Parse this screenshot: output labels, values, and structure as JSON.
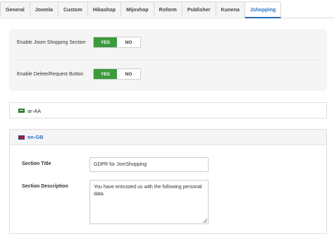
{
  "tabs": [
    {
      "label": "General"
    },
    {
      "label": "Joomla"
    },
    {
      "label": "Custom"
    },
    {
      "label": "Hikashop"
    },
    {
      "label": "Mijoshop"
    },
    {
      "label": "Rsform"
    },
    {
      "label": "Publisher"
    },
    {
      "label": "Kunena"
    },
    {
      "label": "Jshopping",
      "active": true
    }
  ],
  "settings": {
    "enable_section": {
      "label": "Enable Joom Shopping Section",
      "yes": "YES",
      "no": "NO",
      "value": "YES"
    },
    "enable_delete": {
      "label": "Enable Delete/Request Button",
      "yes": "YES",
      "no": "NO",
      "value": "YES"
    }
  },
  "languages": {
    "ar": {
      "label": "ar-AA"
    },
    "en": {
      "label": "en-GB",
      "section_title_label": "Section Title",
      "section_title_value": "GDPR for JomShopping",
      "section_description_label": "Section Description",
      "section_description_value": "You have entrusted us with the following personal data."
    }
  },
  "colors": {
    "accent": "#2a6ebb",
    "yes_active": "#3c9a3c"
  }
}
